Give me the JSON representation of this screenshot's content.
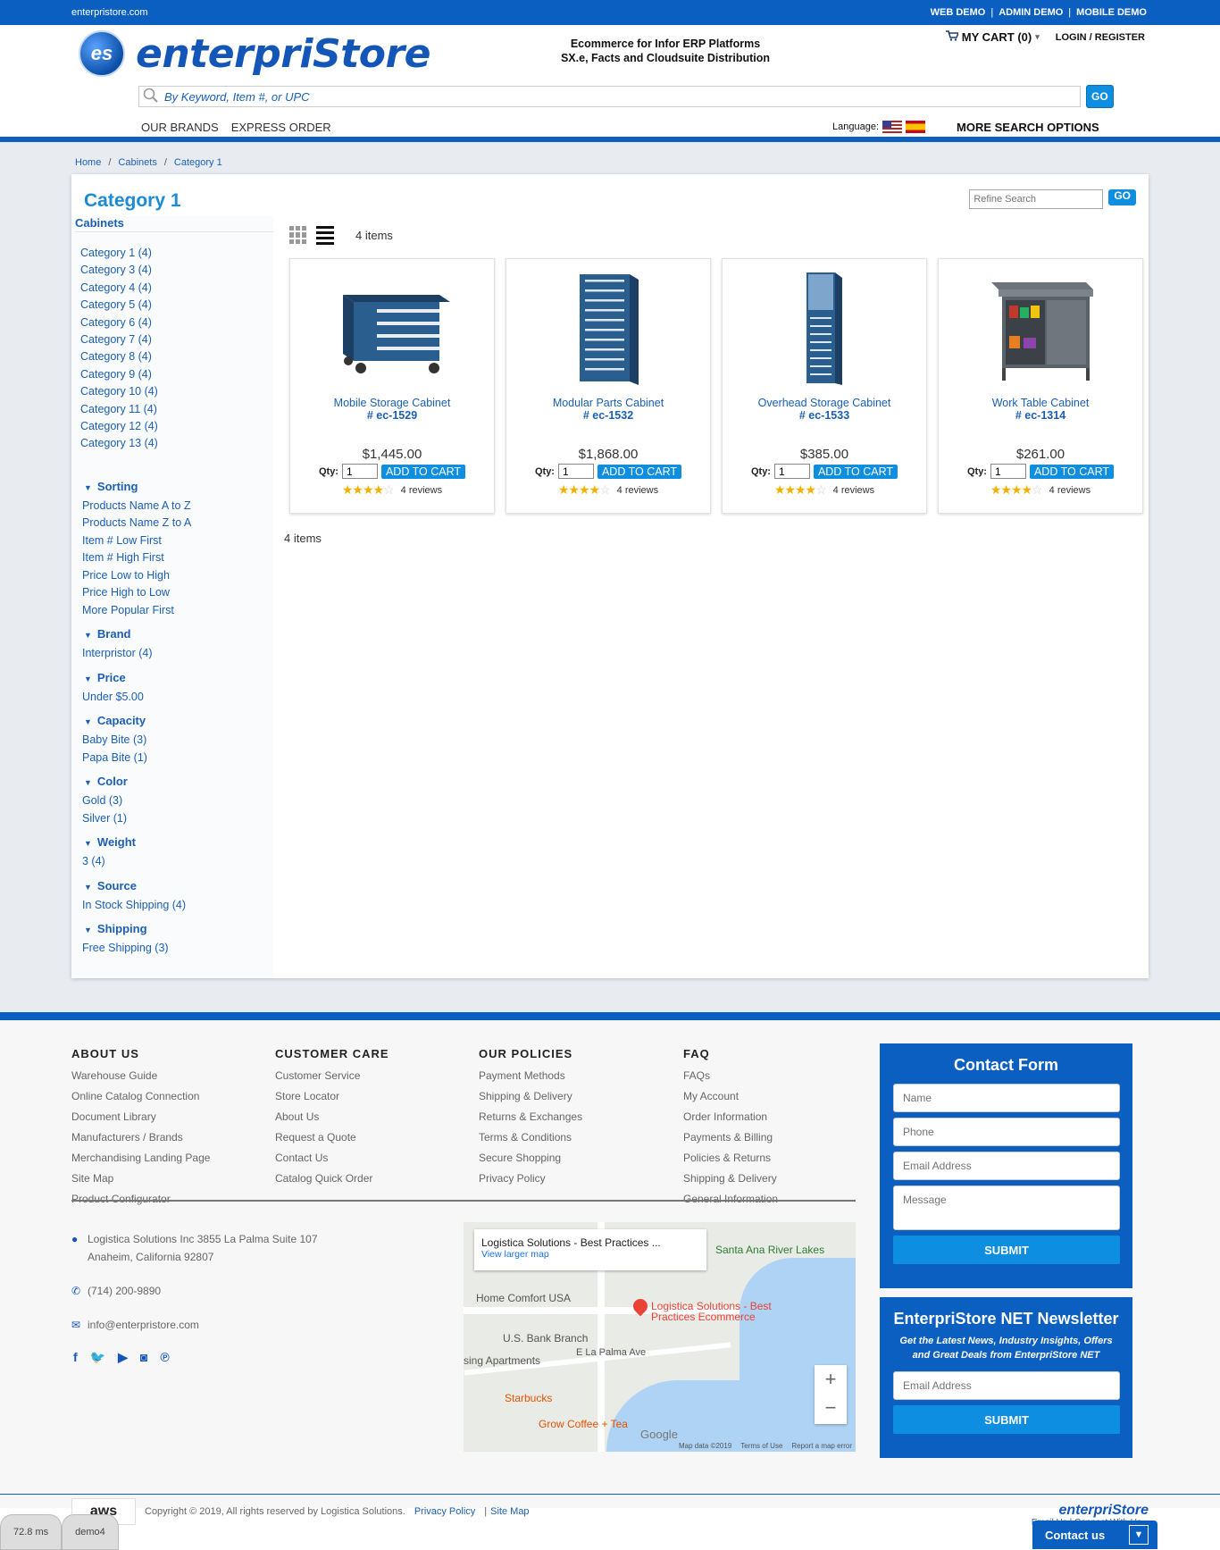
{
  "topbar": {
    "site": "enterpristore.com",
    "links": [
      "WEB DEMO",
      "ADMIN DEMO",
      "MOBILE DEMO"
    ]
  },
  "header": {
    "logo_badge": "es",
    "logo_text": "enterpriStore",
    "tagline_1": "Ecommerce for Infor ERP Platforms",
    "tagline_2": "SX.e, Facts and Cloudsuite Distribution",
    "cart": "MY CART (0)",
    "login": "LOGIN / REGISTER",
    "search_placeholder": "By Keyword, Item #, or UPC",
    "go": "GO",
    "nav": [
      "OUR BRANDS",
      "EXPRESS ORDER"
    ],
    "language_label": "Language:",
    "more_search": "MORE SEARCH OPTIONS"
  },
  "breadcrumb": [
    "Home",
    "Cabinets",
    "Category 1"
  ],
  "page": {
    "title": "Category 1",
    "refine_placeholder": "Refine Search",
    "refine_go": "GO",
    "items_count": "4 items"
  },
  "sidebar": {
    "heading": "Cabinets",
    "categories": [
      "Category 1 (4)",
      "Category 3 (4)",
      "Category 4 (4)",
      "Category 5 (4)",
      "Category 6 (4)",
      "Category 7 (4)",
      "Category 8 (4)",
      "Category 9 (4)",
      "Category 10 (4)",
      "Category 11 (4)",
      "Category 12 (4)",
      "Category 13 (4)"
    ],
    "facets": [
      {
        "title": "Sorting",
        "items": [
          "Products Name A to Z",
          "Products Name Z to A",
          "Item # Low First",
          "Item # High First",
          "Price Low to High",
          "Price High to Low",
          "More Popular First"
        ]
      },
      {
        "title": "Brand",
        "items": [
          "Interpristor (4)"
        ]
      },
      {
        "title": "Price",
        "items": [
          "Under $5.00"
        ]
      },
      {
        "title": "Capacity",
        "items": [
          "Baby Bite (3)",
          "Papa Bite (1)"
        ]
      },
      {
        "title": "Color",
        "items": [
          "Gold (3)",
          "Silver (1)"
        ]
      },
      {
        "title": "Weight",
        "items": [
          "3 (4)"
        ]
      },
      {
        "title": "Source",
        "items": [
          "In Stock Shipping (4)"
        ]
      },
      {
        "title": "Shipping",
        "items": [
          "Free Shipping (3)"
        ]
      }
    ]
  },
  "products": [
    {
      "name": "Mobile Storage Cabinet",
      "sku": "# ec-1529",
      "price": "$1,445.00",
      "qty_label": "Qty:",
      "qty": "1",
      "button": "ADD TO CART",
      "rating": 4,
      "reviews": "4 reviews",
      "kind": "mobile"
    },
    {
      "name": "Modular Parts Cabinet",
      "sku": "# ec-1532",
      "price": "$1,868.00",
      "qty_label": "Qty:",
      "qty": "1",
      "button": "ADD TO CART",
      "rating": 4,
      "reviews": "4 reviews",
      "kind": "modular"
    },
    {
      "name": "Overhead Storage Cabinet",
      "sku": "# ec-1533",
      "price": "$385.00",
      "qty_label": "Qty:",
      "qty": "1",
      "button": "ADD TO CART",
      "rating": 4,
      "reviews": "4 reviews",
      "kind": "overhead"
    },
    {
      "name": "Work Table Cabinet",
      "sku": "# ec-1314",
      "price": "$261.00",
      "qty_label": "Qty:",
      "qty": "1",
      "button": "ADD TO CART",
      "rating": 4,
      "reviews": "4 reviews",
      "kind": "worktable"
    }
  ],
  "footer": {
    "columns": [
      {
        "title": "ABOUT US",
        "links": [
          "Warehouse Guide",
          "Online Catalog Connection",
          "Document Library",
          "Manufacturers / Brands",
          "Merchandising Landing Page",
          "Site Map",
          "Product Configurator"
        ]
      },
      {
        "title": "CUSTOMER CARE",
        "links": [
          "Customer Service",
          "Store Locator",
          "About Us",
          "Request a Quote",
          "Contact Us",
          "Catalog Quick Order"
        ]
      },
      {
        "title": "OUR POLICIES",
        "links": [
          "Payment Methods",
          "Shipping & Delivery",
          "Returns & Exchanges",
          "Terms & Conditions",
          "Secure Shopping",
          "Privacy Policy"
        ]
      },
      {
        "title": "FAQ",
        "links": [
          "FAQs",
          "My Account",
          "Order Information",
          "Payments & Billing",
          "Policies & Returns",
          "Shipping & Delivery",
          "General Information"
        ]
      }
    ],
    "address_1": "Logistica Solutions Inc 3855 La Palma Suite 107",
    "address_2": "Anaheim, California 92807",
    "phone": "(714) 200-9890",
    "email": "info@enterpristore.com",
    "map": {
      "card_title": "Logistica Solutions - Best Practices ...",
      "card_link": "View larger map",
      "pin_label_1": "Logistica Solutions - Best",
      "pin_label_2": "Practices Ecommerce",
      "labels": [
        "Santa Ana River Lakes",
        "Home Comfort USA",
        "U.S. Bank Branch",
        "E La Palma Ave",
        "sing Apartments",
        "Starbucks",
        "Grow Coffee + Tea"
      ],
      "google": "Google",
      "footer_items": [
        "Map data ©2019",
        "Terms of Use",
        "Report a map error"
      ]
    },
    "contact_form": {
      "title": "Contact Form",
      "name": "Name",
      "phone": "Phone",
      "email": "Email Address",
      "message": "Message",
      "submit": "SUBMIT"
    },
    "newsletter": {
      "title": "EnterpriStore NET Newsletter",
      "text": "Get the Latest News, Industry Insights, Offers and Great Deals from EnterpriStore NET",
      "email": "Email Address",
      "submit": "SUBMIT"
    },
    "aws": "aws",
    "copyright": "Copyright © 2019, All rights reserved by Logistica Solutions.",
    "privacy": "Privacy Policy",
    "sitemap": "Site Map",
    "foot_logo": "enterpriStore",
    "foot_links": "Email Us | Connect With Us",
    "contact_tab": "Contact us",
    "debug_tabs": [
      "72.8 ms",
      "demo4"
    ]
  },
  "colors": {
    "brand_blue": "#0b5fc1",
    "accent_blue": "#0e8ee0",
    "link_blue": "#1a5fb4",
    "star": "#f2b100"
  }
}
